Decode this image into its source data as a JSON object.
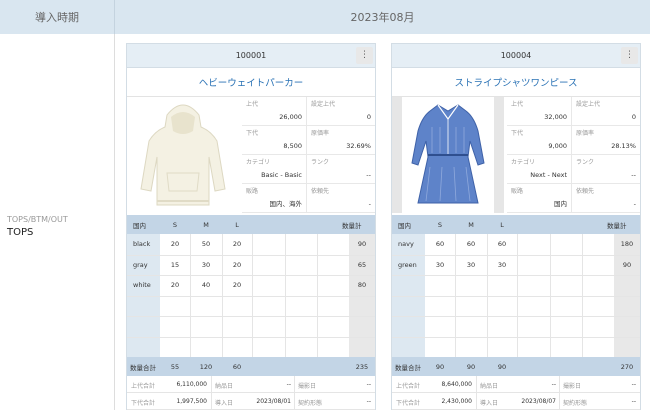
{
  "header": {
    "left_label": "導入時期",
    "period": "2023年08月"
  },
  "category": {
    "sub": "TOPS/BTM/OUT",
    "main": "TOPS"
  },
  "cards": [
    {
      "code": "100001",
      "menu_glyph": "⋮",
      "name": "ヘビーウェイトパーカー",
      "info": {
        "list_price_label": "上代",
        "list_price": "26,000",
        "set_list_price_label": "設定上代",
        "set_list_price": "0",
        "wholesale_label": "下代",
        "wholesale": "8,500",
        "cost_rate_label": "原価率",
        "cost_rate": "32.69%",
        "category_label": "カテゴリ",
        "category": "Basic - Basic",
        "rank_label": "ランク",
        "rank": "--",
        "channel_label": "販路",
        "channel": "国内、海外",
        "requester_label": "依頼先",
        "requester": "-"
      },
      "grid": {
        "headers": [
          "国内",
          "S",
          "M",
          "L",
          "数量計"
        ],
        "rows": [
          {
            "color": "black",
            "s": "20",
            "m": "50",
            "l": "20",
            "total": "90"
          },
          {
            "color": "gray",
            "s": "15",
            "m": "30",
            "l": "20",
            "total": "65"
          },
          {
            "color": "white",
            "s": "20",
            "m": "40",
            "l": "20",
            "total": "80"
          }
        ],
        "totals": {
          "label": "数量合計",
          "s": "55",
          "m": "120",
          "l": "60",
          "total": "235"
        }
      },
      "summary": {
        "list_total_label": "上代合計",
        "list_total": "6,110,000",
        "delivery_label": "納品日",
        "delivery": "--",
        "shoot_label": "撮影日",
        "shoot": "--",
        "wholesale_total_label": "下代合計",
        "wholesale_total": "1,997,500",
        "intro_label": "導入日",
        "intro": "2023/08/01",
        "contract_label": "契約形態",
        "contract": "--"
      }
    },
    {
      "code": "100004",
      "menu_glyph": "⋮",
      "name": "ストライプシャツワンピース",
      "info": {
        "list_price_label": "上代",
        "list_price": "32,000",
        "set_list_price_label": "設定上代",
        "set_list_price": "0",
        "wholesale_label": "下代",
        "wholesale": "9,000",
        "cost_rate_label": "原価率",
        "cost_rate": "28.13%",
        "category_label": "カテゴリ",
        "category": "Next - Next",
        "rank_label": "ランク",
        "rank": "--",
        "channel_label": "販路",
        "channel": "国内",
        "requester_label": "依頼先",
        "requester": "-"
      },
      "grid": {
        "headers": [
          "国内",
          "S",
          "M",
          "L",
          "数量計"
        ],
        "rows": [
          {
            "color": "navy",
            "s": "60",
            "m": "60",
            "l": "60",
            "total": "180"
          },
          {
            "color": "green",
            "s": "30",
            "m": "30",
            "l": "30",
            "total": "90"
          }
        ],
        "totals": {
          "label": "数量合計",
          "s": "90",
          "m": "90",
          "l": "90",
          "total": "270"
        }
      },
      "summary": {
        "list_total_label": "上代合計",
        "list_total": "8,640,000",
        "delivery_label": "納品日",
        "delivery": "--",
        "shoot_label": "撮影日",
        "shoot": "--",
        "wholesale_total_label": "下代合計",
        "wholesale_total": "2,430,000",
        "intro_label": "導入日",
        "intro": "2023/08/07",
        "contract_label": "契約形態",
        "contract": "--"
      }
    }
  ]
}
